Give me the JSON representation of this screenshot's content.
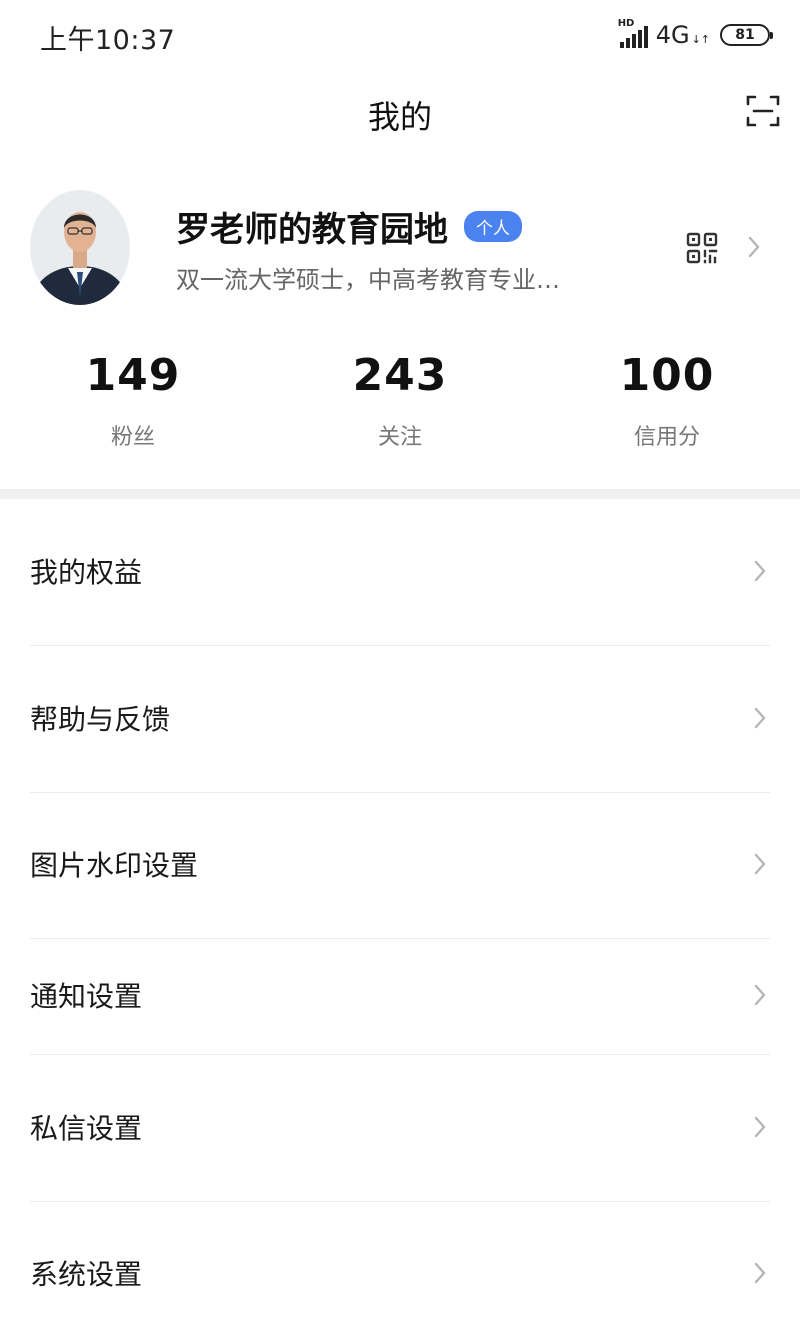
{
  "status_bar": {
    "time": "上午10:37",
    "hd": "HD",
    "network": "4G",
    "network_arrows": "↓↑",
    "battery": "81"
  },
  "header": {
    "title": "我的",
    "scan_icon": "scan-icon"
  },
  "profile": {
    "name": "罗老师的教育园地",
    "badge": "个人",
    "bio": "双一流大学硕士，中高考教育专业…",
    "qr_icon": "qr-code-icon"
  },
  "stats": [
    {
      "value": "149",
      "label": "粉丝"
    },
    {
      "value": "243",
      "label": "关注"
    },
    {
      "value": "100",
      "label": "信用分"
    }
  ],
  "menu": [
    {
      "label": "我的权益"
    },
    {
      "label": "帮助与反馈"
    },
    {
      "label": "图片水印设置"
    },
    {
      "label": "通知设置"
    },
    {
      "label": "私信设置"
    },
    {
      "label": "系统设置"
    }
  ],
  "colors": {
    "accent": "#4a82f0",
    "text": "#1a1a1a",
    "secondary": "#777777",
    "band": "#f1f1f1"
  }
}
